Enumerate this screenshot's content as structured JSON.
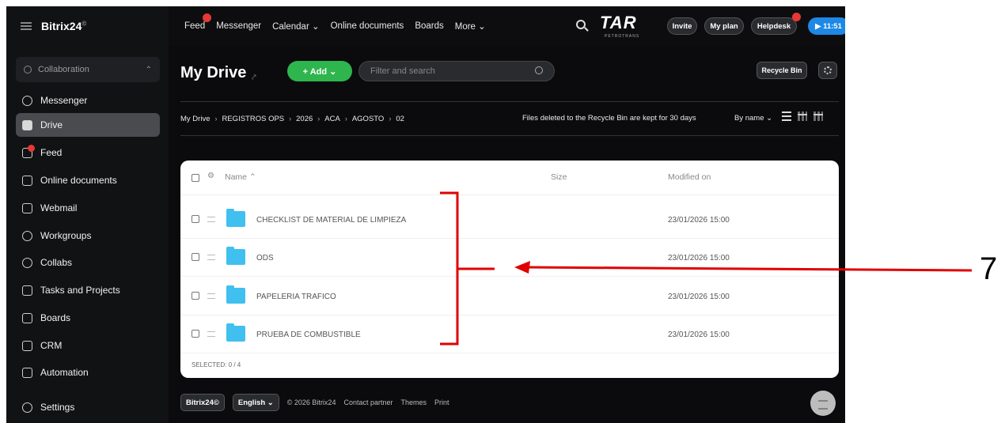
{
  "sidebar": {
    "brand": "Bitrix24",
    "brand_mark": "©",
    "group_label": "Collaboration",
    "items": [
      {
        "label": "Messenger",
        "icon": "chat-icon"
      },
      {
        "label": "Drive",
        "icon": "drive-icon",
        "active": true
      },
      {
        "label": "Feed",
        "icon": "feed-icon",
        "badge": true
      },
      {
        "label": "Online documents",
        "icon": "document-icon"
      },
      {
        "label": "Webmail",
        "icon": "mail-icon"
      },
      {
        "label": "Workgroups",
        "icon": "workgroups-icon"
      },
      {
        "label": "Collabs",
        "icon": "collabs-icon"
      },
      {
        "label": "Tasks and Projects",
        "icon": "tasks-icon"
      },
      {
        "label": "Boards",
        "icon": "boards-icon"
      },
      {
        "label": "CRM",
        "icon": "crm-icon"
      },
      {
        "label": "Automation",
        "icon": "automation-icon"
      },
      {
        "label": "Settings",
        "icon": "settings-icon"
      }
    ]
  },
  "topbar": {
    "nav": [
      "Feed",
      "Messenger",
      "Calendar ⌄",
      "Online documents",
      "Boards",
      "More ⌄"
    ],
    "logo_text": "TAR",
    "logo_sub": "PETROTRANS",
    "invite": "Invite",
    "my_plan": "My plan",
    "helpdesk": "Helpdesk",
    "time": "▶ 11:51"
  },
  "page": {
    "title": "My Drive",
    "add_label": "+ Add ⌄",
    "filter_placeholder": "Filter and search",
    "recycle_bin": "Recycle Bin"
  },
  "breadcrumb": {
    "items": [
      "My Drive",
      "REGISTROS OPS",
      "2026",
      "ACA",
      "AGOSTO",
      "02"
    ],
    "note": "Files deleted to the Recycle Bin are kept for 30 days",
    "sort": "By name ⌄"
  },
  "table": {
    "headers": {
      "name": "Name ⌃",
      "size": "Size",
      "modified": "Modified on"
    },
    "rows": [
      {
        "name": "CHECKLIST DE MATERIAL DE LIMPIEZA",
        "modified": "23/01/2026 15:00"
      },
      {
        "name": "ODS",
        "modified": "23/01/2026 15:00"
      },
      {
        "name": "PAPELERIA TRAFICO",
        "modified": "23/01/2026 15:00"
      },
      {
        "name": "PRUEBA DE COMBUSTIBLE",
        "modified": "23/01/2026 15:00"
      }
    ],
    "selected": "SELECTED: 0 / 4"
  },
  "footer": {
    "brand": "Bitrix24©",
    "language": "English ⌄",
    "copyright": "© 2026 Bitrix24",
    "contact": "Contact partner",
    "themes": "Themes",
    "print": "Print"
  },
  "annotation": {
    "label": "7",
    "color": "#e00000"
  }
}
